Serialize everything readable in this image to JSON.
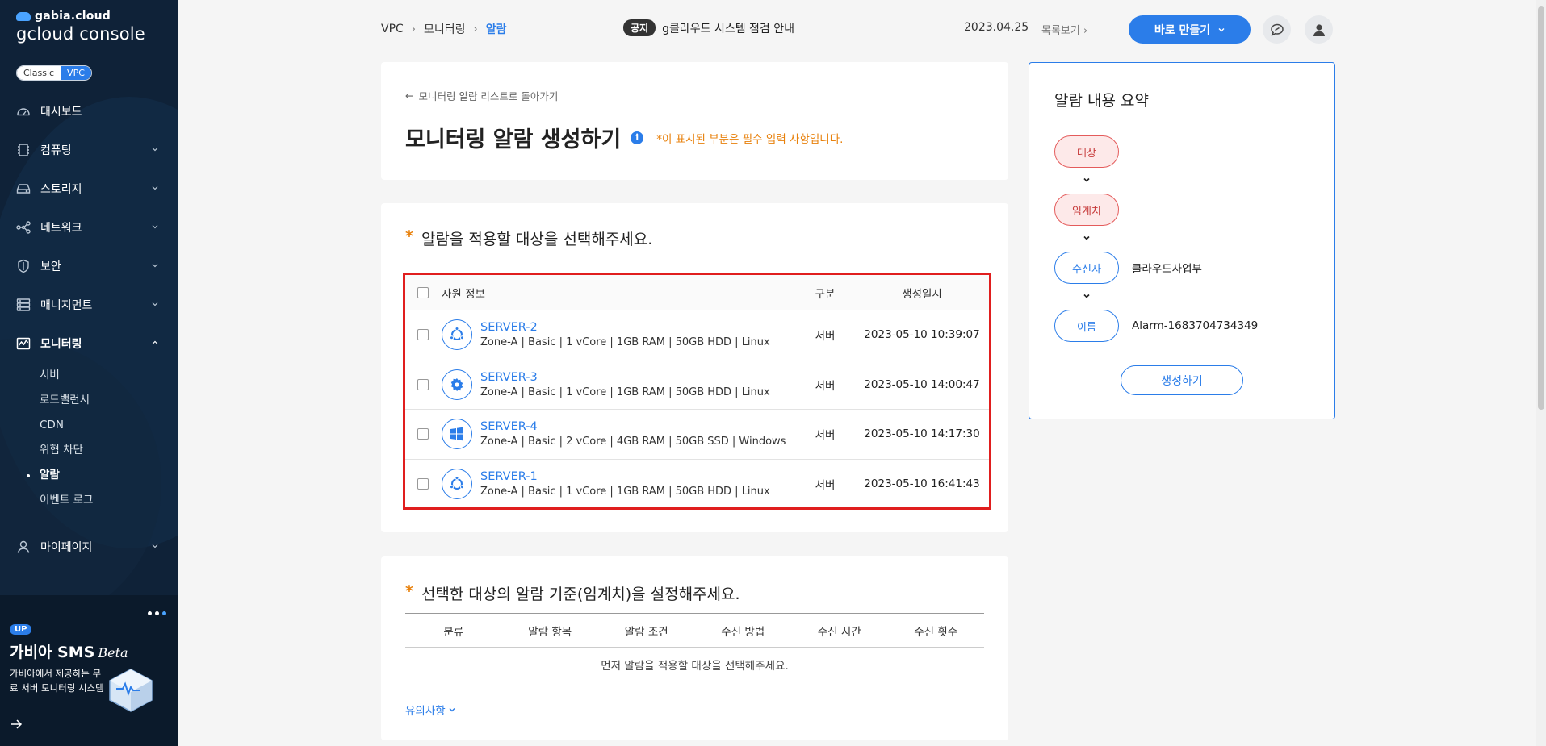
{
  "sidebar": {
    "brand_small": "gabia.cloud",
    "brand_big": "gcloud console",
    "mode": {
      "classic": "Classic",
      "vpc": "VPC"
    },
    "items": [
      {
        "label": "대시보드",
        "icon": "dashboard-icon"
      },
      {
        "label": "컴퓨팅",
        "icon": "computing-icon"
      },
      {
        "label": "스토리지",
        "icon": "storage-icon"
      },
      {
        "label": "네트워크",
        "icon": "network-icon"
      },
      {
        "label": "보안",
        "icon": "shield-icon"
      },
      {
        "label": "매니지먼트",
        "icon": "management-icon"
      },
      {
        "label": "모니터링",
        "icon": "monitoring-icon"
      },
      {
        "label": "마이페이지",
        "icon": "user-icon"
      }
    ],
    "monitoring_sub": [
      "서버",
      "로드밸런서",
      "CDN",
      "위협 차단",
      "알람",
      "이벤트 로그"
    ],
    "promo": {
      "badge": "UP",
      "title": "가비아 SMS",
      "beta": "Beta",
      "desc": "가비아에서 제공하는 무료 서버 모니터링 시스템"
    }
  },
  "header": {
    "breadcrumb": [
      "VPC",
      "모니터링",
      "알람"
    ],
    "notice_tag": "공지",
    "notice_text": "g클라우드 시스템 점검 안내",
    "notice_date": "2023.04.25",
    "more_link": "목록보기",
    "create_button": "바로 만들기"
  },
  "form": {
    "back_link": "모니터링 알람 리스트로 돌아가기",
    "title": "모니터링 알람 생성하기",
    "required_note": "*이 표시된 부분은 필수 입력 사항입니다."
  },
  "target_section": {
    "title": "알람을 적용할 대상을 선택해주세요.",
    "columns": {
      "info": "자원 정보",
      "type": "구분",
      "date": "생성일시"
    },
    "rows": [
      {
        "name": "SERVER-2",
        "spec": "Zone-A | Basic | 1 vCore | 1GB RAM | 50GB HDD | Linux",
        "type": "서버",
        "date": "2023-05-10 10:39:07",
        "os": "ubuntu-icon"
      },
      {
        "name": "SERVER-3",
        "spec": "Zone-A | Basic | 1 vCore | 1GB RAM | 50GB HDD | Linux",
        "type": "서버",
        "date": "2023-05-10 14:00:47",
        "os": "linux-gear-icon"
      },
      {
        "name": "SERVER-4",
        "spec": "Zone-A | Basic | 2 vCore | 4GB RAM | 50GB SSD | Windows",
        "type": "서버",
        "date": "2023-05-10 14:17:30",
        "os": "windows-icon"
      },
      {
        "name": "SERVER-1",
        "spec": "Zone-A | Basic | 1 vCore | 1GB RAM | 50GB HDD | Linux",
        "type": "서버",
        "date": "2023-05-10 16:41:43",
        "os": "ubuntu-icon"
      }
    ]
  },
  "threshold_section": {
    "title": "선택한 대상의 알람 기준(임계치)을 설정해주세요.",
    "columns": [
      "분류",
      "알람 항목",
      "알람 조건",
      "수신 방법",
      "수신 시간",
      "수신 횟수"
    ],
    "empty": "먼저 알람을 적용할 대상을 선택해주세요.",
    "notes_link": "유의사항"
  },
  "summary": {
    "title": "알람 내용 요약",
    "steps": [
      {
        "label": "대상",
        "value": ""
      },
      {
        "label": "임계치",
        "value": ""
      },
      {
        "label": "수신자",
        "value": "클라우드사업부"
      },
      {
        "label": "이름",
        "value": "Alarm-1683704734349"
      }
    ],
    "button": "생성하기"
  }
}
